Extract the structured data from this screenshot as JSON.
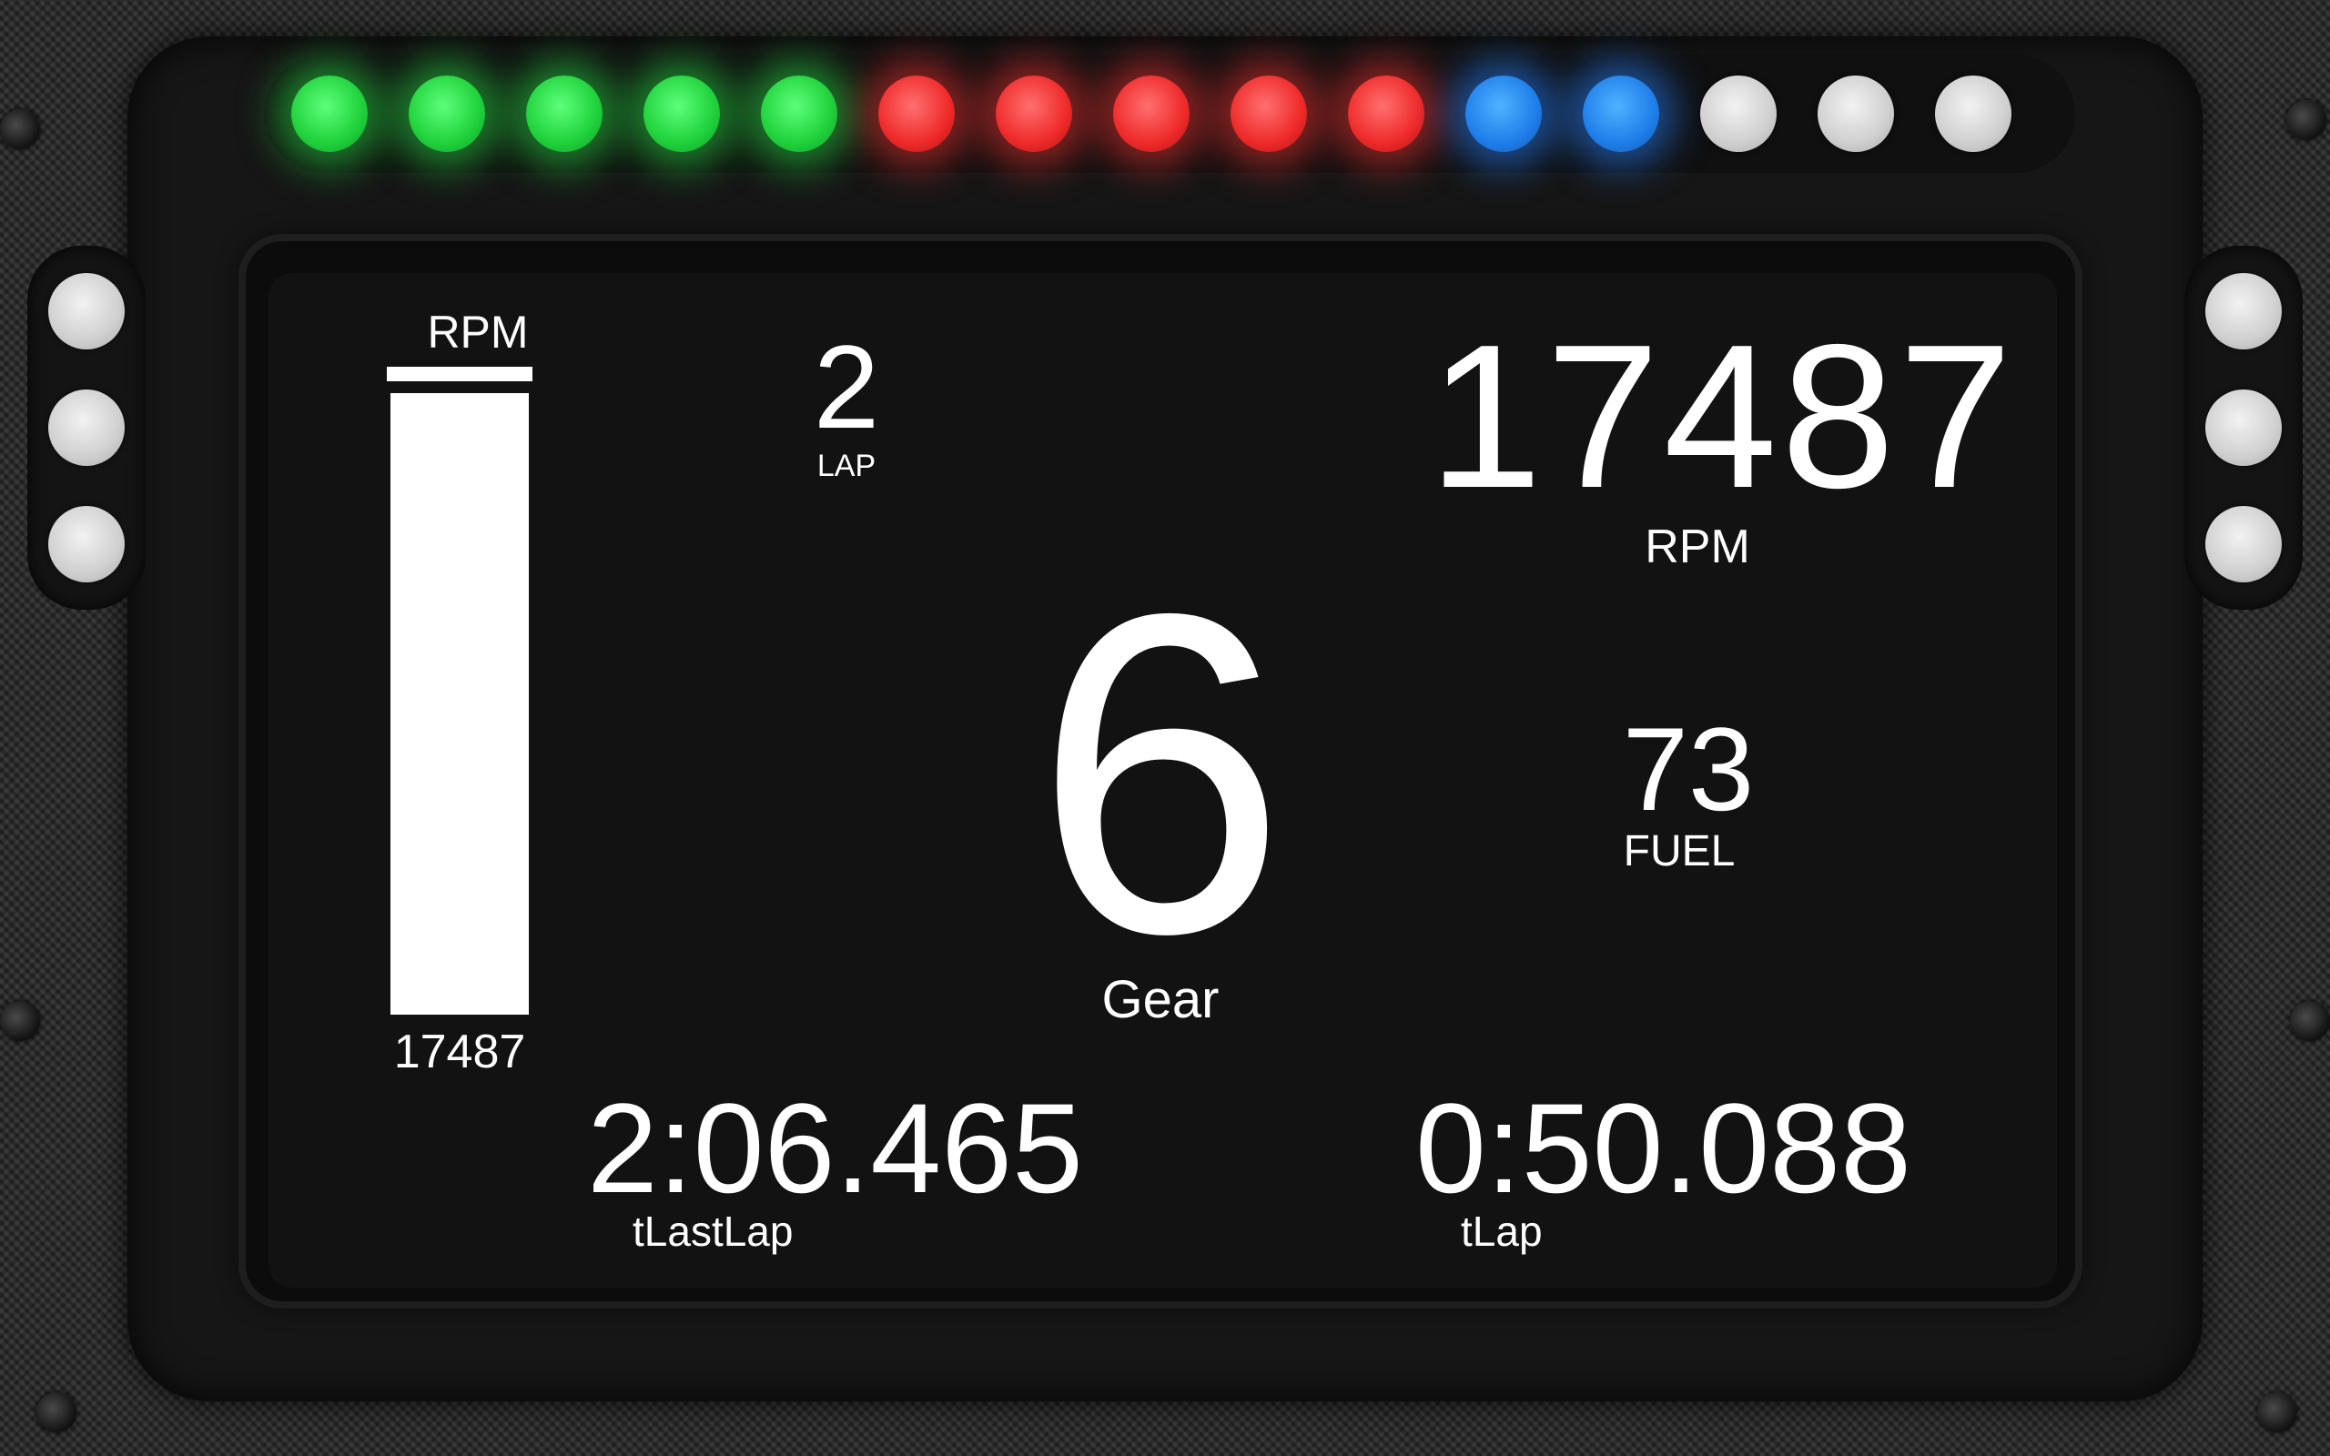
{
  "leds": [
    {
      "color": "green",
      "state": "on"
    },
    {
      "color": "green",
      "state": "on"
    },
    {
      "color": "green",
      "state": "on"
    },
    {
      "color": "green",
      "state": "on"
    },
    {
      "color": "green",
      "state": "on"
    },
    {
      "color": "red",
      "state": "on"
    },
    {
      "color": "red",
      "state": "on"
    },
    {
      "color": "red",
      "state": "on"
    },
    {
      "color": "red",
      "state": "on"
    },
    {
      "color": "red",
      "state": "on"
    },
    {
      "color": "blue",
      "state": "on"
    },
    {
      "color": "blue",
      "state": "on"
    },
    {
      "color": "white",
      "state": "off"
    },
    {
      "color": "white",
      "state": "off"
    },
    {
      "color": "white",
      "state": "off"
    }
  ],
  "side_leds": {
    "left": [
      "off",
      "off",
      "off"
    ],
    "right": [
      "off",
      "off",
      "off"
    ]
  },
  "rpm_bar": {
    "title": "RPM",
    "value": "17487",
    "fill_fraction": 0.99
  },
  "lap": {
    "value": "2",
    "label": "LAP"
  },
  "rpm": {
    "value": "17487",
    "label": "RPM"
  },
  "gear": {
    "value": "6",
    "label": "Gear"
  },
  "fuel": {
    "value": "73",
    "label": "FUEL"
  },
  "last_lap": {
    "value": "2:06.465",
    "label": "tLastLap"
  },
  "current_lap": {
    "value": "0:50.088",
    "label": "tLap"
  },
  "colors": {
    "screen_bg": "#121212",
    "text": "#ffffff",
    "led_green": "#1fd13b",
    "led_red": "#ef2a2a",
    "led_blue": "#1f7eea",
    "led_off": "#cfcfcf"
  }
}
